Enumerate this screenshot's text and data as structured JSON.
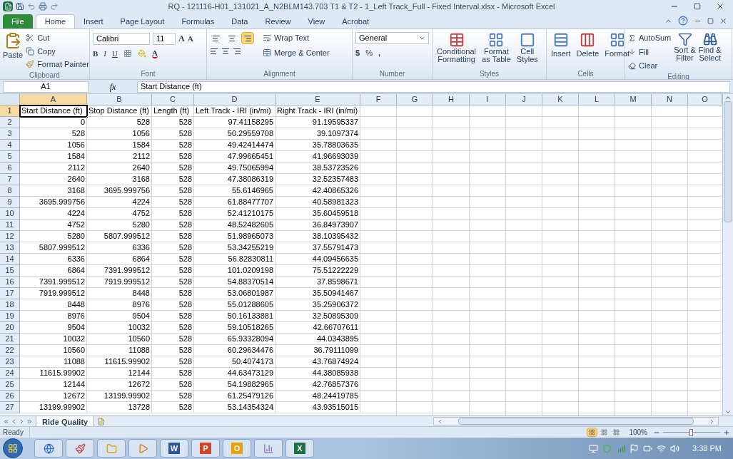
{
  "window": {
    "title": "RQ - 121116-H01_131021_A_N2BLM143.703 T1 & T2 - 1_Left Track_Full - Fixed Interval.xlsx  -  Microsoft Excel"
  },
  "ribbon_tabs": [
    {
      "label": "File",
      "selected": false,
      "kind": "file"
    },
    {
      "label": "Home",
      "selected": true,
      "kind": "tab"
    },
    {
      "label": "Insert",
      "selected": false,
      "kind": "tab"
    },
    {
      "label": "Page Layout",
      "selected": false,
      "kind": "tab"
    },
    {
      "label": "Formulas",
      "selected": false,
      "kind": "tab"
    },
    {
      "label": "Data",
      "selected": false,
      "kind": "tab"
    },
    {
      "label": "Review",
      "selected": false,
      "kind": "tab"
    },
    {
      "label": "View",
      "selected": false,
      "kind": "tab"
    },
    {
      "label": "Acrobat",
      "selected": false,
      "kind": "tab"
    }
  ],
  "clipboard": {
    "label": "Clipboard",
    "paste": "Paste",
    "cut": "Cut",
    "copy": "Copy",
    "format_painter": "Format Painter"
  },
  "font": {
    "label": "Font",
    "name": "Calibri",
    "size": "11",
    "grow": "A",
    "shrink": "A",
    "bold": "B",
    "italic": "I",
    "underline": "U",
    "font_color": "A"
  },
  "alignment": {
    "label": "Alignment",
    "wrap": "Wrap Text",
    "merge": "Merge & Center",
    "vertical": [
      {
        "selected": false
      },
      {
        "selected": false
      },
      {
        "selected": true
      }
    ]
  },
  "number": {
    "label": "Number",
    "format": "General",
    "currency": "$",
    "percent": "%",
    "comma": ","
  },
  "styles": {
    "label": "Styles",
    "buttons": [
      {
        "lines": [
          "Conditional",
          "Formatting"
        ]
      },
      {
        "lines": [
          "Format",
          "as Table"
        ]
      },
      {
        "lines": [
          "Cell",
          "Styles"
        ]
      }
    ]
  },
  "cells": {
    "label": "Cells",
    "buttons": [
      "Insert",
      "Delete",
      "Format"
    ]
  },
  "editing": {
    "label": "Editing",
    "autosum": "AutoSum",
    "fill": "Fill",
    "clear": "Clear",
    "sort": [
      "Sort &",
      "Filter"
    ],
    "find": [
      "Find &",
      "Select"
    ]
  },
  "formula_bar": {
    "name_box": "A1",
    "fx": "fx",
    "value": "Start Distance (ft)"
  },
  "columns": [
    {
      "label": "A",
      "selected": true
    },
    {
      "label": "B",
      "selected": false
    },
    {
      "label": "C",
      "selected": false
    },
    {
      "label": "D",
      "selected": false
    },
    {
      "label": "E",
      "selected": false
    },
    {
      "label": "F",
      "selected": false
    },
    {
      "label": "G",
      "selected": false
    },
    {
      "label": "H",
      "selected": false
    },
    {
      "label": "I",
      "selected": false
    },
    {
      "label": "J",
      "selected": false
    },
    {
      "label": "K",
      "selected": false
    },
    {
      "label": "L",
      "selected": false
    },
    {
      "label": "M",
      "selected": false
    },
    {
      "label": "N",
      "selected": false
    },
    {
      "label": "O",
      "selected": false
    }
  ],
  "rows": [
    {
      "number": "1",
      "selected": true,
      "cells": [
        "Start Distance (ft)",
        "Stop Distance (ft)",
        "Length (ft)",
        "Left Track - IRI (in/mi)",
        "Right Track - IRI (in/mi)"
      ]
    },
    {
      "number": "2",
      "selected": false,
      "cells": [
        "0",
        "528",
        "528",
        "97.41158295",
        "91.19595337"
      ]
    },
    {
      "number": "3",
      "selected": false,
      "cells": [
        "528",
        "1056",
        "528",
        "50.29559708",
        "39.1097374"
      ]
    },
    {
      "number": "4",
      "selected": false,
      "cells": [
        "1056",
        "1584",
        "528",
        "49.42414474",
        "35.78803635"
      ]
    },
    {
      "number": "5",
      "selected": false,
      "cells": [
        "1584",
        "2112",
        "528",
        "47.99665451",
        "41.96693039"
      ]
    },
    {
      "number": "6",
      "selected": false,
      "cells": [
        "2112",
        "2640",
        "528",
        "49.75065994",
        "38.53723526"
      ]
    },
    {
      "number": "7",
      "selected": false,
      "cells": [
        "2640",
        "3168",
        "528",
        "47.38086319",
        "32.52357483"
      ]
    },
    {
      "number": "8",
      "selected": false,
      "cells": [
        "3168",
        "3695.999756",
        "528",
        "55.6146965",
        "42.40865326"
      ]
    },
    {
      "number": "9",
      "selected": false,
      "cells": [
        "3695.999756",
        "4224",
        "528",
        "61.88477707",
        "40.58981323"
      ]
    },
    {
      "number": "10",
      "selected": false,
      "cells": [
        "4224",
        "4752",
        "528",
        "52.41210175",
        "35.60459518"
      ]
    },
    {
      "number": "11",
      "selected": false,
      "cells": [
        "4752",
        "5280",
        "528",
        "48.52482605",
        "36.84973907"
      ]
    },
    {
      "number": "12",
      "selected": false,
      "cells": [
        "5280",
        "5807.999512",
        "528",
        "51.98965073",
        "38.10395432"
      ]
    },
    {
      "number": "13",
      "selected": false,
      "cells": [
        "5807.999512",
        "6336",
        "528",
        "53.34255219",
        "37.55791473"
      ]
    },
    {
      "number": "14",
      "selected": false,
      "cells": [
        "6336",
        "6864",
        "528",
        "56.82830811",
        "44.09456635"
      ]
    },
    {
      "number": "15",
      "selected": false,
      "cells": [
        "6864",
        "7391.999512",
        "528",
        "101.0209198",
        "75.51222229"
      ]
    },
    {
      "number": "16",
      "selected": false,
      "cells": [
        "7391.999512",
        "7919.999512",
        "528",
        "54.88370514",
        "37.8598671"
      ]
    },
    {
      "number": "17",
      "selected": false,
      "cells": [
        "7919.999512",
        "8448",
        "528",
        "53.06801987",
        "35.50941467"
      ]
    },
    {
      "number": "18",
      "selected": false,
      "cells": [
        "8448",
        "8976",
        "528",
        "55.01288605",
        "35.25906372"
      ]
    },
    {
      "number": "19",
      "selected": false,
      "cells": [
        "8976",
        "9504",
        "528",
        "50.16133881",
        "32.50895309"
      ]
    },
    {
      "number": "20",
      "selected": false,
      "cells": [
        "9504",
        "10032",
        "528",
        "59.10518265",
        "42.66707611"
      ]
    },
    {
      "number": "21",
      "selected": false,
      "cells": [
        "10032",
        "10560",
        "528",
        "65.93328094",
        "44.0343895"
      ]
    },
    {
      "number": "22",
      "selected": false,
      "cells": [
        "10560",
        "11088",
        "528",
        "60.29634476",
        "36.79111099"
      ]
    },
    {
      "number": "23",
      "selected": false,
      "cells": [
        "11088",
        "11615.99902",
        "528",
        "50.4074173",
        "43.76874924"
      ]
    },
    {
      "number": "24",
      "selected": false,
      "cells": [
        "11615.99902",
        "12144",
        "528",
        "44.63473129",
        "44.38085938"
      ]
    },
    {
      "number": "25",
      "selected": false,
      "cells": [
        "12144",
        "12672",
        "528",
        "54.19882965",
        "42.76857376"
      ]
    },
    {
      "number": "26",
      "selected": false,
      "cells": [
        "12672",
        "13199.99902",
        "528",
        "61.25479126",
        "48.24419785"
      ]
    },
    {
      "number": "27",
      "selected": false,
      "cells": [
        "13199.99902",
        "13728",
        "528",
        "53.14354324",
        "43.93515015"
      ]
    }
  ],
  "sheet_tabs": [
    {
      "label": "Ride Quality",
      "selected": true
    }
  ],
  "status_bar": {
    "text": "Ready",
    "views": [
      {
        "selected": true
      },
      {
        "selected": false
      },
      {
        "selected": false
      }
    ],
    "zoom": "100%",
    "level": 0.5
  },
  "taskbar": {
    "apps": [
      {
        "kind": "browser"
      },
      {
        "kind": "paint"
      },
      {
        "kind": "folder"
      },
      {
        "kind": "media"
      },
      {
        "kind": "letter",
        "letter": "W",
        "color": "#2b5797"
      },
      {
        "kind": "letter",
        "letter": "P",
        "color": "#d24726"
      },
      {
        "kind": "letter",
        "letter": "O",
        "color": "#e8a100"
      },
      {
        "kind": "chart"
      },
      {
        "kind": "letter",
        "letter": "X",
        "color": "#1e7145"
      }
    ],
    "clock": "3:38 PM"
  }
}
